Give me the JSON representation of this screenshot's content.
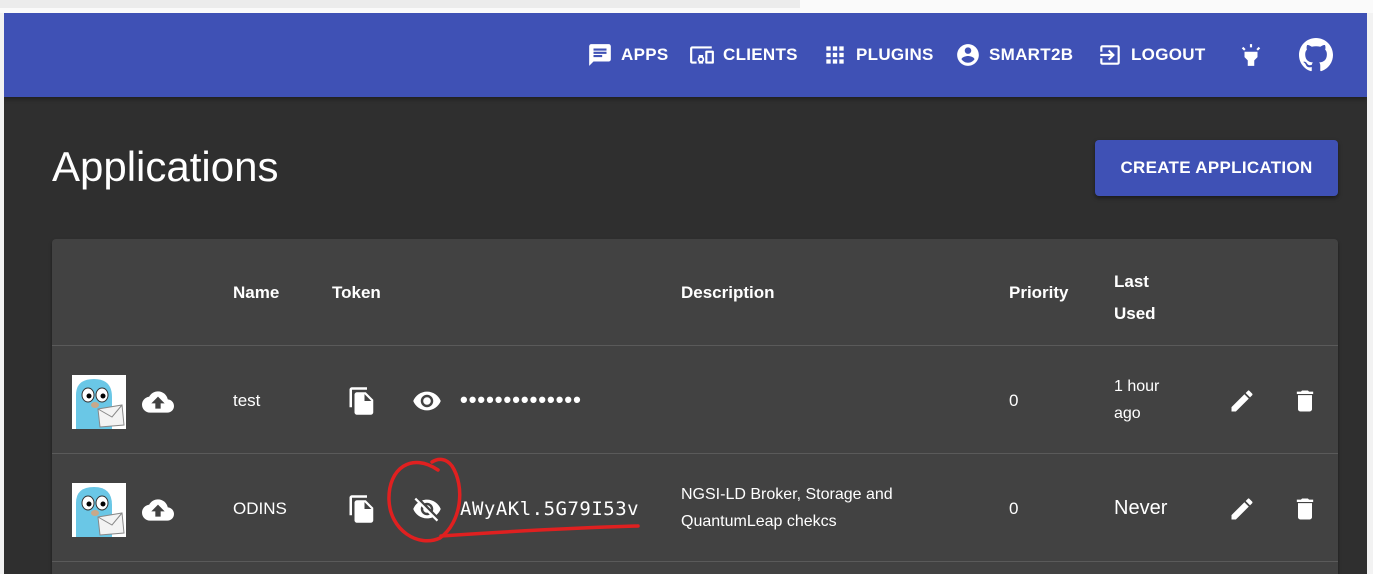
{
  "nav": {
    "apps": "APPS",
    "clients": "CLIENTS",
    "plugins": "PLUGINS",
    "user": "SMART2B",
    "logout": "LOGOUT",
    "icons": [
      "message-icon",
      "devices-icon",
      "apps-grid-icon",
      "account-circle-icon",
      "logout-icon",
      "highlight-icon",
      "github-icon"
    ]
  },
  "page": {
    "title": "Applications",
    "create_button": "CREATE APPLICATION"
  },
  "table": {
    "headers": {
      "name": "Name",
      "token": "Token",
      "description": "Description",
      "priority": "Priority",
      "last_used_line1": "Last",
      "last_used_line2": "Used"
    },
    "rows": [
      {
        "name": "test",
        "token": "••••••••••••••",
        "token_visible": false,
        "description": "",
        "priority": "0",
        "last_used_line1": "1 hour",
        "last_used_line2": "ago"
      },
      {
        "name": "ODINS",
        "token": "AWyAKl.5G79I53v",
        "token_visible": true,
        "description_line1": "NGSI-LD Broker, Storage and",
        "description_line2": "QuantumLeap chekcs",
        "priority": "0",
        "last_used": "Never"
      }
    ]
  },
  "colors": {
    "appbar": "#3f51b5",
    "background": "#2f2f2f",
    "card": "#424242",
    "annotation": "#e02020"
  }
}
